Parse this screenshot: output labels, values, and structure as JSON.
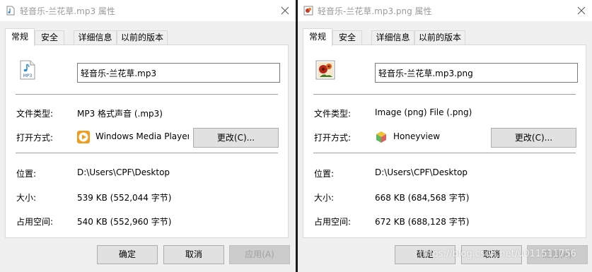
{
  "left": {
    "title": "轻音乐-兰花草.mp3 属性",
    "tabs": [
      "常规",
      "安全",
      "详细信息",
      "以前的版本"
    ],
    "icon": "mp3-file-icon",
    "filename": "轻音乐-兰花草.mp3",
    "type_label": "文件类型:",
    "type_value": "MP3 格式声音 (.mp3)",
    "open_label": "打开方式:",
    "app_name": "Windows Media Player",
    "change_button": "更改(C)...",
    "location_label": "位置:",
    "location_value": "D:\\Users\\CPF\\Desktop",
    "size_label": "大小:",
    "size_value": "539 KB (552,044 字节)",
    "disk_label": "占用空间:",
    "disk_value": "540 KB (552,960 字节)",
    "ok": "确定",
    "cancel": "取消",
    "apply": "应用(A)"
  },
  "right": {
    "title": "轻音乐-兰花草.mp3.png 属性",
    "tabs": [
      "常规",
      "安全",
      "详细信息",
      "以前的版本"
    ],
    "icon": "png-image-icon",
    "filename": "轻音乐-兰花草.mp3.png",
    "type_label": "文件类型:",
    "type_value": "Image (png) File (.png)",
    "open_label": "打开方式:",
    "app_name": "Honeyview",
    "change_button": "更改(C)...",
    "location_label": "位置:",
    "location_value": "D:\\Users\\CPF\\Desktop",
    "size_label": "大小:",
    "size_value": "668 KB (684,568 字节)",
    "disk_label": "占用空间:",
    "disk_value": "672 KB (688,128 字节)",
    "ok": "确定",
    "cancel": "取消",
    "apply": "应用(A)"
  },
  "watermark": "https://blog.csdn.net/u011511756",
  "colors": {
    "title_text": "#9a9a9a",
    "panel": "#ffffff",
    "window_bg": "#f0f0f0",
    "divider": "#1a1a1a"
  }
}
